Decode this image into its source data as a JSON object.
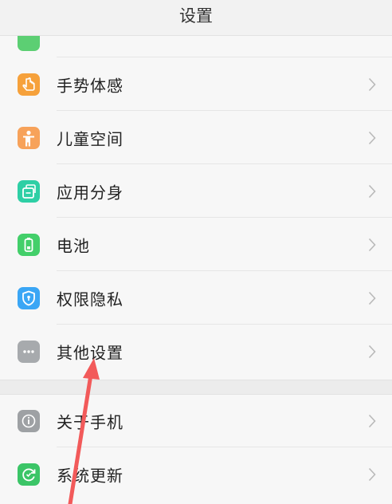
{
  "header": {
    "title": "设置"
  },
  "icon_colors": {
    "gesture": "#f6a13b",
    "kids": "#f7a25a",
    "clone": "#2ecfa5",
    "battery": "#43cf6a",
    "privacy": "#3aa6f5",
    "more": "#a7aaad",
    "about": "#9ea1a4",
    "update": "#3bc567",
    "partial": "#5ccf73"
  },
  "section1": {
    "items": [
      {
        "label": "手势体感",
        "icon": "hand-icon"
      },
      {
        "label": "儿童空间",
        "icon": "child-icon"
      },
      {
        "label": "应用分身",
        "icon": "app-clone-icon"
      },
      {
        "label": "电池",
        "icon": "battery-icon"
      },
      {
        "label": "权限隐私",
        "icon": "shield-icon"
      },
      {
        "label": "其他设置",
        "icon": "more-dots-icon"
      }
    ]
  },
  "section2": {
    "items": [
      {
        "label": "关于手机",
        "icon": "info-icon"
      },
      {
        "label": "系统更新",
        "icon": "update-icon"
      }
    ]
  },
  "annotation": {
    "color": "#f25a5a"
  }
}
